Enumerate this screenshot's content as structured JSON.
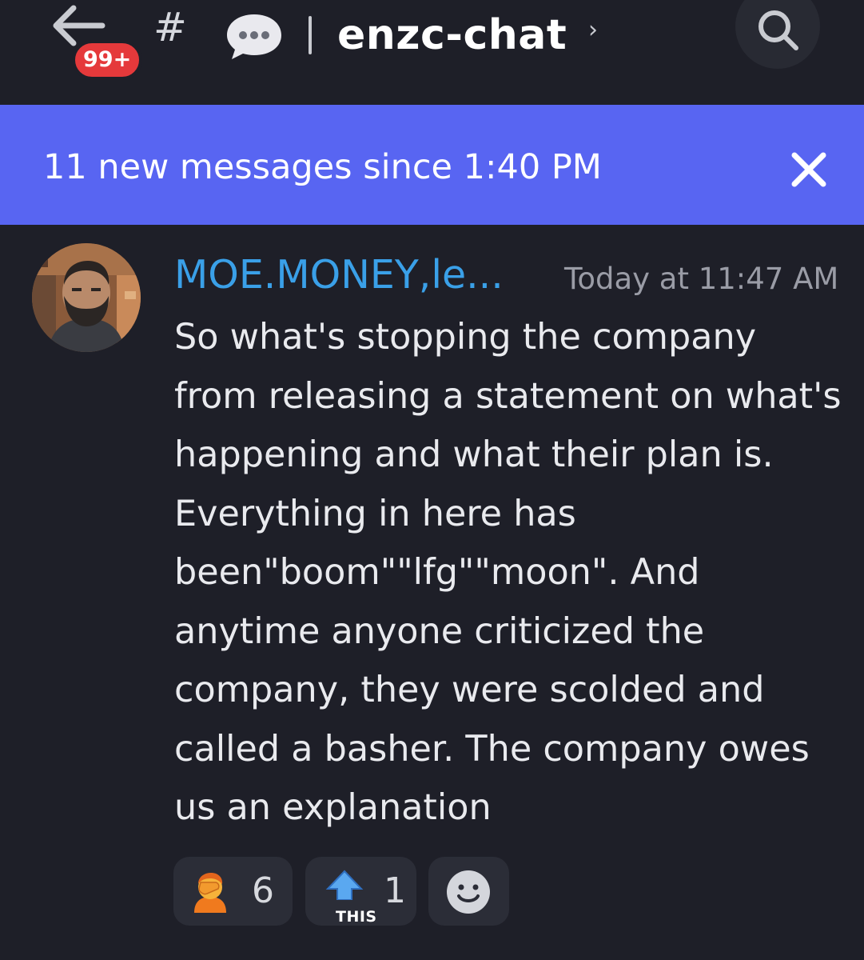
{
  "header": {
    "back_icon": "arrow-left-icon",
    "unread_badge": "99+",
    "channel_prefix": "#",
    "channel_type_icon": "speech-bubble-icon",
    "channel_name": "enzc-chat",
    "chevron": "›",
    "search_icon": "search-icon"
  },
  "banner": {
    "text": "11 new messages since 1:40 PM",
    "close_icon": "close-icon",
    "color": "#5865f2"
  },
  "message": {
    "author": "MOE.MONEY,le...",
    "author_color": "#3aa0e8",
    "timestamp": "Today at 11:47 AM",
    "text": "So what's stopping the company\nfrom releasing a statement on what's\nhappening and what their plan is.\nEverything in here has\nbeen\"boom\"\"lfg\"\"moon\". And\nanytime anyone criticized the\ncompany, they were scolded and\ncalled a basher. The company owes\nus an explanation"
  },
  "reactions": [
    {
      "emoji": "person-facepalming-emoji",
      "count": "6"
    },
    {
      "emoji": "this-arrow-emoji",
      "label": "THIS",
      "count": "1"
    },
    {
      "emoji": "add-reaction-smiley-icon"
    }
  ]
}
